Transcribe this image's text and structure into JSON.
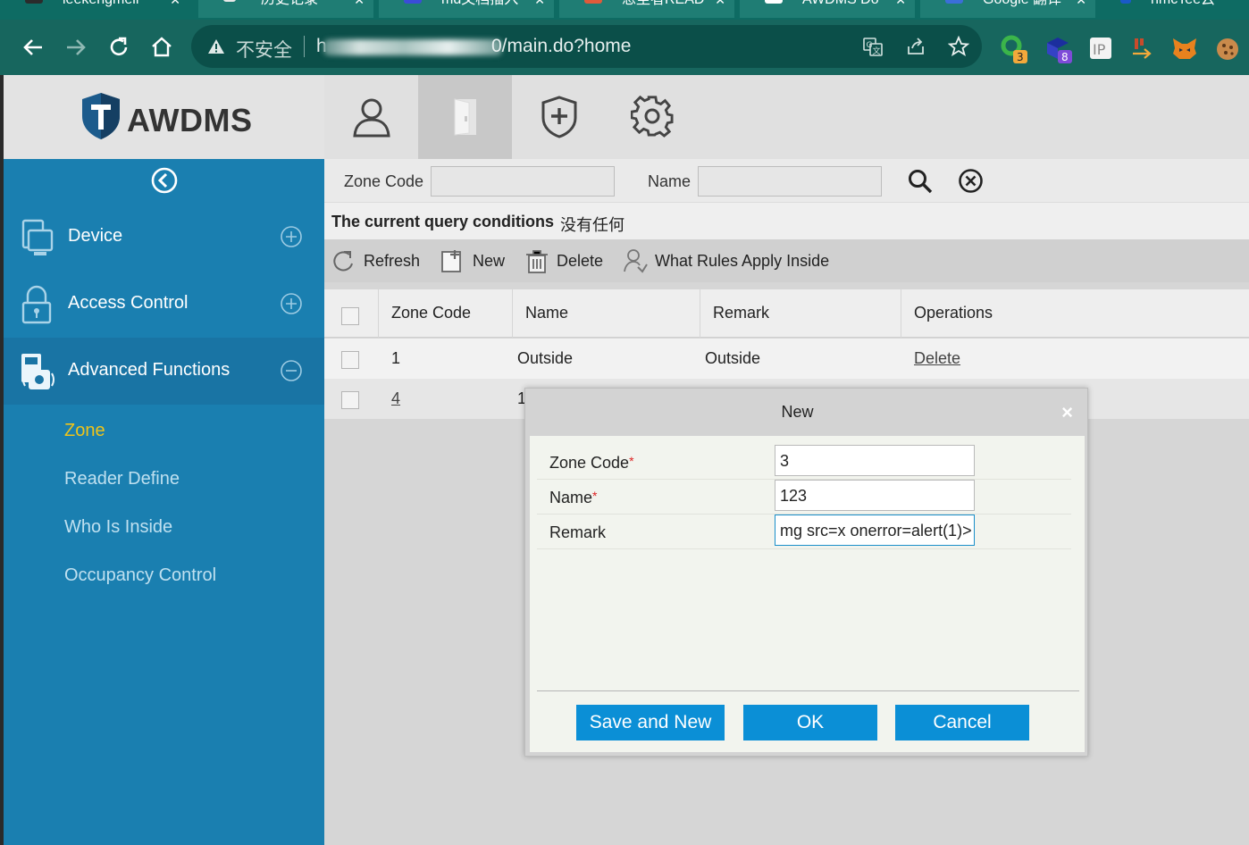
{
  "browser": {
    "tabs": [
      {
        "label": "leekengmeir",
        "favicon_color": "#2b2b2b"
      },
      {
        "label": "历史记录",
        "favicon_color": "#1f7d74"
      },
      {
        "label": "md文档插入",
        "favicon_color": "#3b4bd8"
      },
      {
        "label": "悲尘者READ",
        "favicon_color": "#e05a3a"
      },
      {
        "label": "AWDMS Do",
        "favicon_color": "#ffffff"
      },
      {
        "label": "Google 翻译",
        "favicon_color": "#3b6ed8"
      },
      {
        "label": "nmcTee云",
        "favicon_color": "#1a59c8"
      }
    ],
    "security_label": "不安全",
    "url_prefix": "h",
    "url_suffix": "0/main.do?home",
    "extensions": [
      {
        "icon": "green-circle-extension-icon",
        "badge": "3"
      },
      {
        "icon": "purple-cube-extension-icon",
        "badge": "8"
      },
      {
        "icon": "ip-extension-icon",
        "badge": "IP"
      },
      {
        "icon": "orange-arrow-extension-icon",
        "badge": ""
      },
      {
        "icon": "metamask-fox-icon",
        "badge": ""
      },
      {
        "icon": "cookie-icon",
        "badge": ""
      }
    ]
  },
  "app": {
    "brand": "AWDMS",
    "top_nav": [
      "person-icon",
      "door-icon",
      "shield-plus-icon",
      "gear-icon"
    ],
    "active_top_nav": 1
  },
  "sidebar": {
    "items": [
      {
        "label": "Device",
        "icon": "device-icon",
        "state": "collapsed"
      },
      {
        "label": "Access Control",
        "icon": "lock-icon",
        "state": "collapsed"
      },
      {
        "label": "Advanced Functions",
        "icon": "advanced-icon",
        "state": "expanded"
      }
    ],
    "sub_items": [
      {
        "label": "Zone",
        "active": true
      },
      {
        "label": "Reader Define",
        "active": false
      },
      {
        "label": "Who Is Inside",
        "active": false
      },
      {
        "label": "Occupancy Control",
        "active": false
      }
    ]
  },
  "search": {
    "zone_code_label": "Zone Code",
    "name_label": "Name",
    "zone_code_value": "",
    "name_value": ""
  },
  "query": {
    "label": "The current query conditions",
    "value": "没有任何"
  },
  "actions": {
    "refresh": "Refresh",
    "new": "New",
    "delete": "Delete",
    "rules": "What Rules Apply Inside"
  },
  "table": {
    "columns": [
      "Zone Code",
      "Name",
      "Remark",
      "Operations"
    ],
    "rows": [
      {
        "zone_code": "1",
        "name": "Outside",
        "remark": "Outside",
        "operation": "Delete"
      },
      {
        "zone_code": "4",
        "name": "1",
        "remark": "",
        "operation": ""
      }
    ]
  },
  "modal": {
    "title": "New",
    "close": "×",
    "fields": [
      {
        "label": "Zone Code",
        "required": true,
        "value": "3"
      },
      {
        "label": "Name",
        "required": true,
        "value": "123"
      },
      {
        "label": "Remark",
        "required": false,
        "value": "mg src=x onerror=alert(1)>"
      }
    ],
    "required_mark": "*",
    "buttons": {
      "save_and_new": "Save and New",
      "ok": "OK",
      "cancel": "Cancel"
    }
  }
}
